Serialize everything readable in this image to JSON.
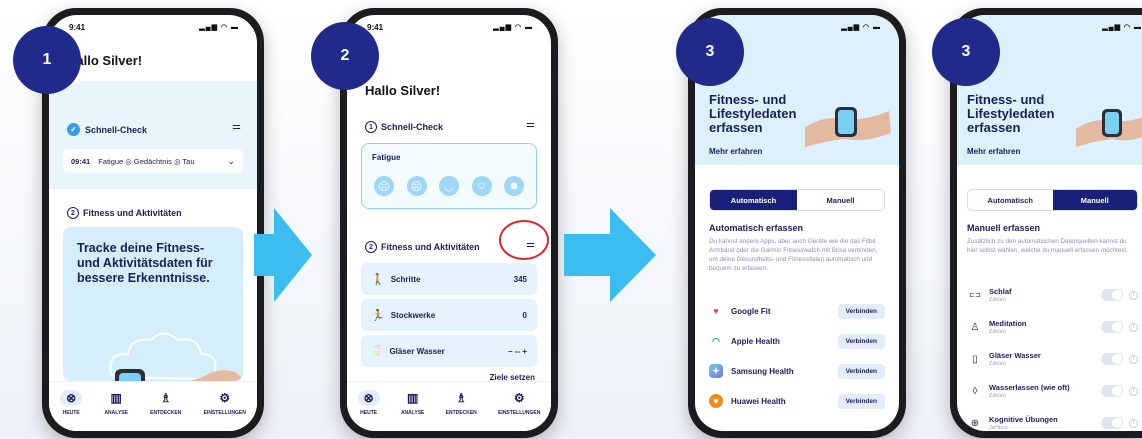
{
  "status": {
    "time_1": "9:41",
    "time_2": "9:41",
    "icons": "▂▄▆ ◠ ▬"
  },
  "badges": [
    "1",
    "2",
    "3",
    "3"
  ],
  "screen1": {
    "greeting": "Hallo Silver!",
    "schnell_check": "Schnell-Check",
    "checkbar": {
      "time": "09:41",
      "items": "Fatigue ◎  Gedächtnis ◎  Tau"
    },
    "section2_num": "2",
    "section2_title": "Fitness und Aktivitäten",
    "promo_text": "Tracke deine Fitness- und Aktivitätsdaten für bessere Erkenntnisse."
  },
  "screen2": {
    "greeting": "Hallo Silver!",
    "section1_num": "1",
    "section1_title": "Schnell-Check",
    "fatigue_label": "Fatigue",
    "section2_num": "2",
    "section2_title": "Fitness und Aktivitäten",
    "stats": [
      {
        "label": "Schritte",
        "value": "345",
        "icon": "walk-icon",
        "glyph": "🚶"
      },
      {
        "label": "Stockwerke",
        "value": "0",
        "icon": "stairs-icon",
        "glyph": "🏃"
      },
      {
        "label": "Gläser Wasser",
        "value": "–  --  +",
        "icon": "glass-icon",
        "glyph": "🥛"
      }
    ],
    "goals_link": "Ziele setzen"
  },
  "tabs": [
    {
      "label": "HEUTE",
      "icon": "today-icon",
      "glyph": "⊗"
    },
    {
      "label": "ANALYSE",
      "icon": "analysis-icon",
      "glyph": "▥"
    },
    {
      "label": "ENTDECKEN",
      "icon": "discover-icon",
      "glyph": "♗"
    },
    {
      "label": "EINSTELLUNGEN",
      "icon": "settings-icon",
      "glyph": "⚙"
    }
  ],
  "screen3": {
    "title": "Fitness- und Lifestyledaten erfassen",
    "more_link": "Mehr erfahren",
    "seg_auto": "Automatisch",
    "seg_manual": "Manuell",
    "auto_heading": "Automatisch erfassen",
    "auto_body": "Du kannst andere Apps, aber auch Geräte wie die das Fitbit Armband oder die Garmin Fitnesswatch mit Brisa verbinden, um deine Gesundheits- und Fitnessdaten automatisch und bequem zu erfassen.",
    "connect_label": "Verbinden",
    "apps": [
      {
        "name": "Google Fit",
        "icon": "google-fit-icon",
        "color": "#e8453c"
      },
      {
        "name": "Apple Health",
        "icon": "apple-health-icon",
        "color": "#1a8cff"
      },
      {
        "name": "Samsung Health",
        "icon": "samsung-health-icon",
        "color": "#2bb8a0"
      },
      {
        "name": "Huawei Health",
        "icon": "huawei-health-icon",
        "color": "#f08a1c"
      }
    ]
  },
  "screen4": {
    "title": "Fitness- und Lifestyledaten erfassen",
    "more_link": "Mehr erfahren",
    "seg_auto": "Automatisch",
    "seg_manual": "Manuell",
    "manual_heading": "Manuell erfassen",
    "manual_body": "Zusätzlich zu den automatischen Datenquellen kannst du hier selbst wählen, welche du manuell erfassen möchtest.",
    "items": [
      {
        "label": "Schlaf",
        "sub": "Zählen",
        "icon": "bed-icon",
        "glyph": "⊏⊐"
      },
      {
        "label": "Meditation",
        "sub": "Zählen",
        "icon": "meditation-icon",
        "glyph": "♙"
      },
      {
        "label": "Gläser Wasser",
        "sub": "Zählen",
        "icon": "glass-icon",
        "glyph": "▯"
      },
      {
        "label": "Wasserlassen (wie oft)",
        "sub": "Zählen",
        "icon": "drop-icon",
        "glyph": "◊"
      },
      {
        "label": "Kognitive Übungen",
        "sub": "Ja/Nein",
        "icon": "brain-icon",
        "glyph": "⊕"
      }
    ],
    "info_glyph": "i"
  },
  "colors": {
    "navy": "#1a1f7a",
    "arrow": "#3bbdf0",
    "light_blue": "#e4f3fd"
  }
}
